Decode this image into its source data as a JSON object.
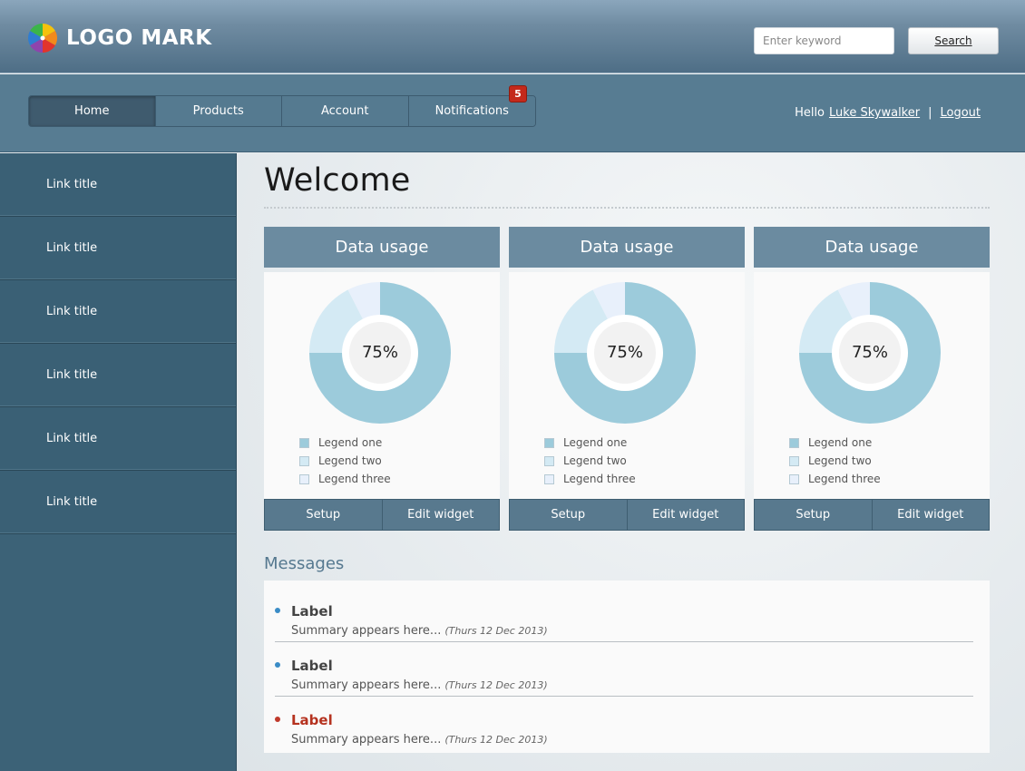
{
  "header": {
    "logo_text": "LOGO MARK",
    "search": {
      "placeholder": "Enter keyword",
      "button_label": "Search"
    }
  },
  "nav": {
    "tabs": [
      {
        "label": "Home",
        "active": true
      },
      {
        "label": "Products"
      },
      {
        "label": "Account"
      },
      {
        "label": "Notifications",
        "badge": "5"
      }
    ],
    "greeting": "Hello",
    "user_name": "Luke Skywalker",
    "separator": "|",
    "logout_label": "Logout"
  },
  "sidebar": {
    "items": [
      {
        "label": "Link title"
      },
      {
        "label": "Link title"
      },
      {
        "label": "Link title"
      },
      {
        "label": "Link title"
      },
      {
        "label": "Link title"
      },
      {
        "label": "Link title"
      }
    ]
  },
  "main": {
    "title": "Welcome",
    "widgets": [
      {
        "title": "Data usage",
        "percent_label": "75%",
        "legend": [
          "Legend one",
          "Legend two",
          "Legend three"
        ],
        "buttons": [
          "Setup",
          "Edit widget"
        ]
      },
      {
        "title": "Data usage",
        "percent_label": "75%",
        "legend": [
          "Legend one",
          "Legend two",
          "Legend three"
        ],
        "buttons": [
          "Setup",
          "Edit widget"
        ]
      },
      {
        "title": "Data usage",
        "percent_label": "75%",
        "legend": [
          "Legend one",
          "Legend two",
          "Legend three"
        ],
        "buttons": [
          "Setup",
          "Edit widget"
        ]
      }
    ],
    "messages_title": "Messages",
    "messages": [
      {
        "label": "Label",
        "summary": "Summary appears here...",
        "date": "(Thurs 12 Dec 2013)",
        "status_color": "#3a8cc6",
        "label_color": "#444444"
      },
      {
        "label": "Label",
        "summary": "Summary appears here...",
        "date": "(Thurs 12 Dec 2013)",
        "status_color": "#3a8cc6",
        "label_color": "#444444"
      },
      {
        "label": "Label",
        "summary": "Summary appears here...",
        "date": "(Thurs 12 Dec 2013)",
        "status_color": "#c0392b",
        "label_color": "#b5321f"
      }
    ]
  },
  "chart_data": [
    {
      "type": "pie",
      "categories": [
        "Legend one",
        "Legend two",
        "Legend three"
      ],
      "values": [
        75,
        17.5,
        7.5
      ],
      "colors": [
        "#9ccbdb",
        "#d4eaf4",
        "#e8f0fb"
      ]
    },
    {
      "type": "pie",
      "categories": [
        "Legend one",
        "Legend two",
        "Legend three"
      ],
      "values": [
        75,
        17.5,
        7.5
      ],
      "colors": [
        "#9ccbdb",
        "#d4eaf4",
        "#e8f0fb"
      ]
    },
    {
      "type": "pie",
      "categories": [
        "Legend one",
        "Legend two",
        "Legend three"
      ],
      "values": [
        75,
        17.5,
        7.5
      ],
      "colors": [
        "#9ccbdb",
        "#d4eaf4",
        "#e8f0fb"
      ]
    }
  ]
}
